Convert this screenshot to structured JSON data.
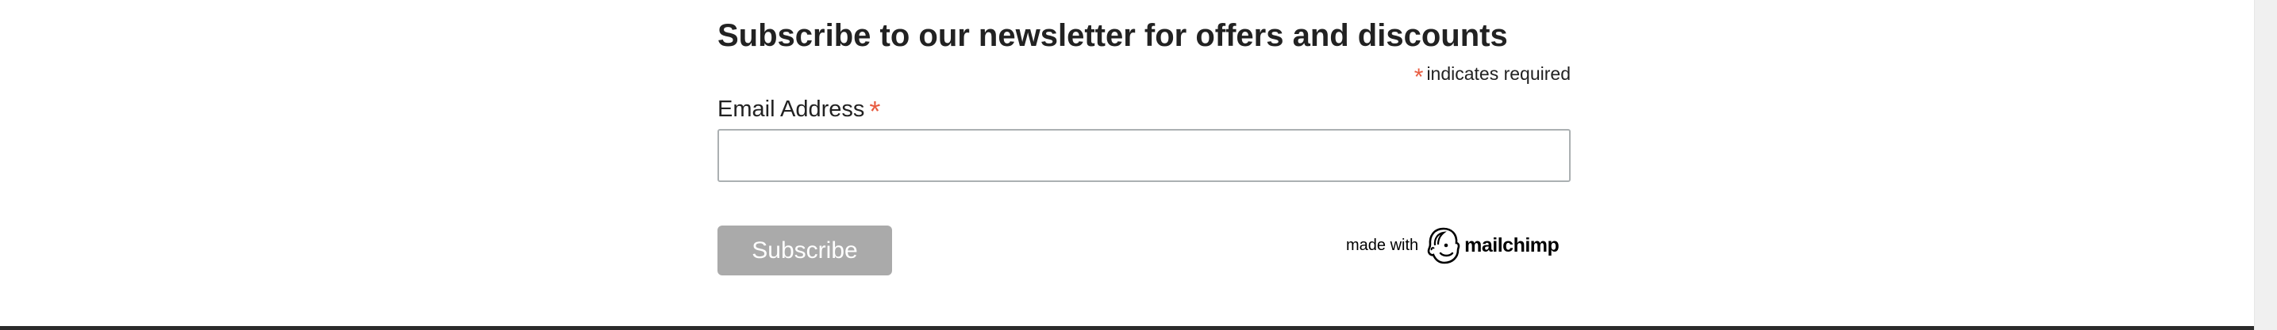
{
  "newsletter": {
    "title": "Subscribe to our newsletter for offers and discounts",
    "required_marker": "*",
    "required_note": "indicates required",
    "email_label": "Email Address",
    "email_value": "",
    "subscribe_label": "Subscribe"
  },
  "badge": {
    "made_with": "made with",
    "brand": "mailchimp",
    "icon": "mailchimp-freddie-icon"
  },
  "colors": {
    "required_asterisk": "#e85c41",
    "button_bg": "#aaaaaa",
    "input_border": "#abb0b2",
    "footer_rule": "#2b2b2b"
  }
}
